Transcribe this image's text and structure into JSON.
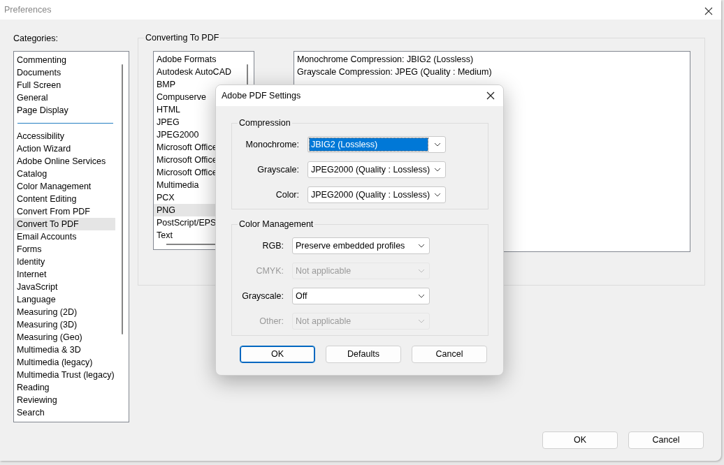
{
  "window": {
    "title": "Preferences"
  },
  "categories": {
    "label": "Categories:",
    "groups": [
      [
        {
          "label": "Commenting",
          "selected": false
        },
        {
          "label": "Documents",
          "selected": false
        },
        {
          "label": "Full Screen",
          "selected": false
        },
        {
          "label": "General",
          "selected": false
        },
        {
          "label": "Page Display",
          "selected": false
        }
      ],
      [
        {
          "label": "Accessibility",
          "selected": false
        },
        {
          "label": "Action Wizard",
          "selected": false
        },
        {
          "label": "Adobe Online Services",
          "selected": false
        },
        {
          "label": "Catalog",
          "selected": false
        },
        {
          "label": "Color Management",
          "selected": false
        },
        {
          "label": "Content Editing",
          "selected": false
        },
        {
          "label": "Convert From PDF",
          "selected": false
        },
        {
          "label": "Convert To PDF",
          "selected": true
        },
        {
          "label": "Email Accounts",
          "selected": false
        },
        {
          "label": "Forms",
          "selected": false
        },
        {
          "label": "Identity",
          "selected": false
        },
        {
          "label": "Internet",
          "selected": false
        },
        {
          "label": "JavaScript",
          "selected": false
        },
        {
          "label": "Language",
          "selected": false
        },
        {
          "label": "Measuring (2D)",
          "selected": false
        },
        {
          "label": "Measuring (3D)",
          "selected": false
        },
        {
          "label": "Measuring (Geo)",
          "selected": false
        },
        {
          "label": "Multimedia & 3D",
          "selected": false
        },
        {
          "label": "Multimedia (legacy)",
          "selected": false
        },
        {
          "label": "Multimedia Trust (legacy)",
          "selected": false
        },
        {
          "label": "Reading",
          "selected": false
        },
        {
          "label": "Reviewing",
          "selected": false
        },
        {
          "label": "Search",
          "selected": false
        }
      ]
    ]
  },
  "converting": {
    "title": "Converting To PDF",
    "formats": [
      {
        "label": "Adobe Formats",
        "selected": false
      },
      {
        "label": "Autodesk AutoCAD",
        "selected": false
      },
      {
        "label": "BMP",
        "selected": false
      },
      {
        "label": "Compuserve",
        "selected": false
      },
      {
        "label": "HTML",
        "selected": false
      },
      {
        "label": "JPEG",
        "selected": false
      },
      {
        "label": "JPEG2000",
        "selected": false
      },
      {
        "label": "Microsoft Office",
        "selected": false
      },
      {
        "label": "Microsoft Office",
        "selected": false
      },
      {
        "label": "Microsoft Office",
        "selected": false
      },
      {
        "label": "Multimedia",
        "selected": false
      },
      {
        "label": "PCX",
        "selected": false
      },
      {
        "label": "PNG",
        "selected": true
      },
      {
        "label": "PostScript/EPS",
        "selected": false
      },
      {
        "label": "Text",
        "selected": false
      }
    ],
    "description": [
      "Monochrome Compression: JBIG2 (Lossless)",
      "Grayscale Compression: JPEG (Quality : Medium)"
    ]
  },
  "buttons": [
    "OK",
    "Cancel"
  ],
  "dialog": {
    "title": "Adobe PDF Settings",
    "groups": [
      {
        "title": "Compression",
        "rows": [
          {
            "label": "Monochrome:",
            "value": "JBIG2 (Lossless)",
            "disabled": false,
            "focused": true
          },
          {
            "label": "Grayscale:",
            "value": "JPEG2000 (Quality : Lossless)",
            "disabled": false,
            "focused": false
          },
          {
            "label": "Color:",
            "value": "JPEG2000 (Quality : Lossless)",
            "disabled": false,
            "focused": false
          }
        ]
      },
      {
        "title": "Color Management",
        "rows": [
          {
            "label": "RGB:",
            "value": "Preserve embedded profiles",
            "disabled": false,
            "focused": false
          },
          {
            "label": "CMYK:",
            "value": "Not applicable",
            "disabled": true,
            "focused": false
          },
          {
            "label": "Grayscale:",
            "value": "Off",
            "disabled": false,
            "focused": false
          },
          {
            "label": "Other:",
            "value": "Not applicable",
            "disabled": true,
            "focused": false
          }
        ]
      }
    ],
    "buttons": [
      {
        "label": "OK",
        "default": true
      },
      {
        "label": "Defaults",
        "default": false
      },
      {
        "label": "Cancel",
        "default": false
      }
    ]
  }
}
